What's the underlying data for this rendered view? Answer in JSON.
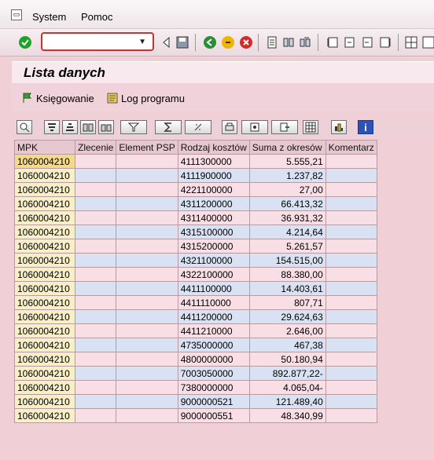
{
  "menu": {
    "items": [
      "System",
      "Pomoc"
    ]
  },
  "toolbar": {
    "command_value": ""
  },
  "screen": {
    "title": "Lista danych"
  },
  "app_toolbar": {
    "posting_label": "Księgowanie",
    "log_label": "Log programu"
  },
  "table": {
    "headers": [
      "MPK",
      "Zlecenie",
      "Element PSP",
      "Rodzaj kosztów",
      "Suma z okresów",
      "Komentarz"
    ],
    "rows": [
      [
        "1060004210",
        "",
        "",
        "4111300000",
        "5.555,21",
        ""
      ],
      [
        "1060004210",
        "",
        "",
        "4111900000",
        "1.237,82",
        ""
      ],
      [
        "1060004210",
        "",
        "",
        "4221100000",
        "27,00",
        ""
      ],
      [
        "1060004210",
        "",
        "",
        "4311200000",
        "66.413,32",
        ""
      ],
      [
        "1060004210",
        "",
        "",
        "4311400000",
        "36.931,32",
        ""
      ],
      [
        "1060004210",
        "",
        "",
        "4315100000",
        "4.214,64",
        ""
      ],
      [
        "1060004210",
        "",
        "",
        "4315200000",
        "5.261,57",
        ""
      ],
      [
        "1060004210",
        "",
        "",
        "4321100000",
        "154.515,00",
        ""
      ],
      [
        "1060004210",
        "",
        "",
        "4322100000",
        "88.380,00",
        ""
      ],
      [
        "1060004210",
        "",
        "",
        "4411100000",
        "14.403,61",
        ""
      ],
      [
        "1060004210",
        "",
        "",
        "4411110000",
        "807,71",
        ""
      ],
      [
        "1060004210",
        "",
        "",
        "4411200000",
        "29.624,63",
        ""
      ],
      [
        "1060004210",
        "",
        "",
        "4411210000",
        "2.646,00",
        ""
      ],
      [
        "1060004210",
        "",
        "",
        "4735000000",
        "467,38",
        ""
      ],
      [
        "1060004210",
        "",
        "",
        "4800000000",
        "50.180,94",
        ""
      ],
      [
        "1060004210",
        "",
        "",
        "7003050000",
        "892.877,22-",
        ""
      ],
      [
        "1060004210",
        "",
        "",
        "7380000000",
        "4.065,04-",
        ""
      ],
      [
        "1060004210",
        "",
        "",
        "9000000521",
        "121.489,40",
        ""
      ],
      [
        "1060004210",
        "",
        "",
        "9000000551",
        "48.340,99",
        ""
      ]
    ]
  },
  "colors": {
    "header_bg": "#e7c8d0",
    "row_even": "#f8dee5",
    "row_odd": "#d9e2f3",
    "key_highlight": "#f3d98a"
  }
}
